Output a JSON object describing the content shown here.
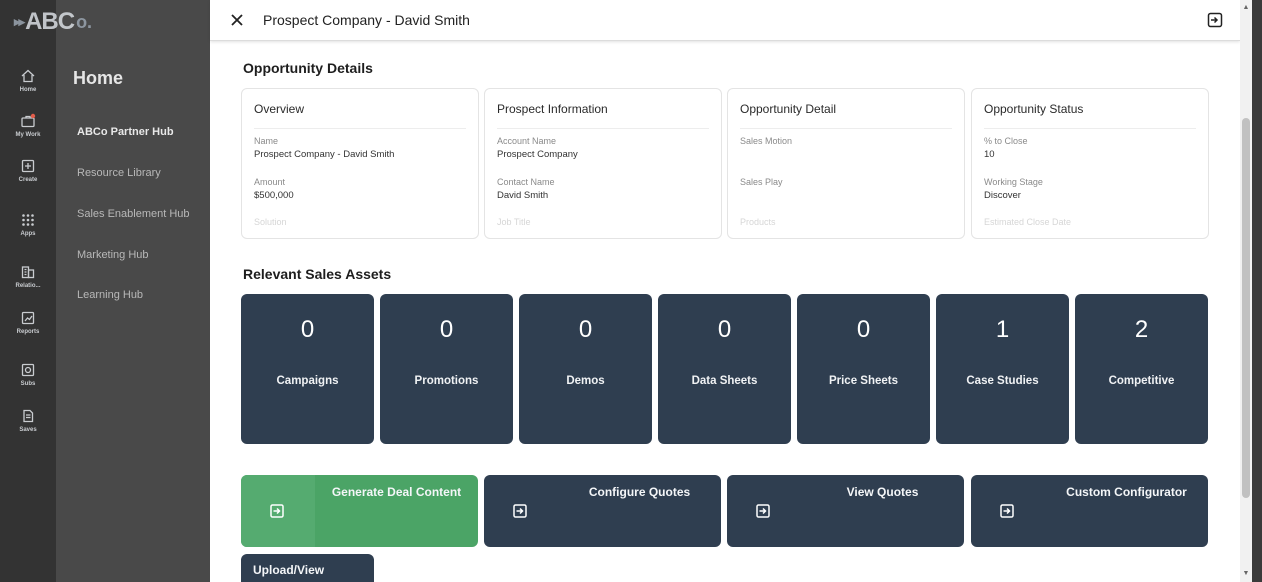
{
  "app": {
    "logo_text": "ABC",
    "logo_suffix": "o."
  },
  "rail": {
    "items": [
      {
        "label": "Home",
        "icon": "home-icon"
      },
      {
        "label": "My Work",
        "icon": "briefcase-icon"
      },
      {
        "label": "Create",
        "icon": "plus-square-icon"
      },
      {
        "label": "Apps",
        "icon": "grid-icon"
      },
      {
        "label": "Relatio...",
        "icon": "building-icon"
      },
      {
        "label": "Reports",
        "icon": "chart-icon"
      },
      {
        "label": "Subs",
        "icon": "gear-icon"
      },
      {
        "label": "Saves",
        "icon": "document-icon"
      }
    ]
  },
  "nav": {
    "title": "Home",
    "items": [
      "ABCo Partner Hub",
      "Resource Library",
      "Sales Enablement Hub",
      "Marketing Hub",
      "Learning Hub"
    ]
  },
  "panel": {
    "title": "Prospect Company - David Smith"
  },
  "opportunity_details": {
    "section_title": "Opportunity Details",
    "cards": [
      {
        "title": "Overview",
        "fields": [
          {
            "label": "Name",
            "value": "Prospect Company - David Smith"
          },
          {
            "label": "Amount",
            "value": "$500,000"
          },
          {
            "label": "Solution",
            "value": ""
          }
        ]
      },
      {
        "title": "Prospect Information",
        "fields": [
          {
            "label": "Account Name",
            "value": "Prospect Company"
          },
          {
            "label": "Contact Name",
            "value": "David Smith"
          },
          {
            "label": "Job Title",
            "value": ""
          }
        ]
      },
      {
        "title": "Opportunity Detail",
        "fields": [
          {
            "label": "Sales Motion",
            "value": ""
          },
          {
            "label": "Sales Play",
            "value": ""
          },
          {
            "label": "Products",
            "value": ""
          }
        ]
      },
      {
        "title": "Opportunity Status",
        "fields": [
          {
            "label": "% to Close",
            "value": "10"
          },
          {
            "label": "Working Stage",
            "value": "Discover"
          },
          {
            "label": "Estimated Close Date",
            "value": ""
          }
        ]
      }
    ]
  },
  "sales_assets": {
    "section_title": "Relevant Sales Assets",
    "tiles": [
      {
        "count": "0",
        "label": "Campaigns"
      },
      {
        "count": "0",
        "label": "Promotions"
      },
      {
        "count": "0",
        "label": "Demos"
      },
      {
        "count": "0",
        "label": "Data Sheets"
      },
      {
        "count": "0",
        "label": "Price Sheets"
      },
      {
        "count": "1",
        "label": "Case Studies"
      },
      {
        "count": "2",
        "label": "Competitive"
      }
    ]
  },
  "actions": [
    {
      "label": "Generate Deal Content",
      "color": "#4ba466"
    },
    {
      "label": "Configure Quotes",
      "color": "#2f3e50"
    },
    {
      "label": "View Quotes",
      "color": "#2f3e50"
    },
    {
      "label": "Custom Configurator",
      "color": "#2f3e50"
    },
    {
      "label": "Upload/View",
      "color": "#2f3e50"
    }
  ]
}
